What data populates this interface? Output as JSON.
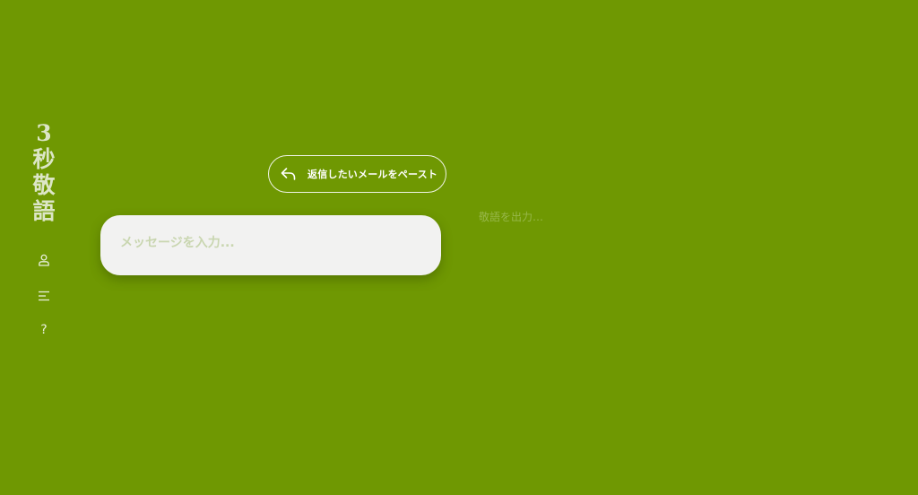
{
  "sidebar": {
    "logo_chars": [
      "3",
      "秒",
      "敬",
      "語"
    ],
    "nav": [
      {
        "icon": "user-icon"
      },
      {
        "icon": "menu-icon"
      },
      {
        "icon": "help-icon",
        "glyph": "?"
      }
    ]
  },
  "paste_button": {
    "icon": "reply-icon",
    "label": "返信したいメールをペースト"
  },
  "message_input": {
    "placeholder": "メッセージを入力...",
    "value": ""
  },
  "output": {
    "placeholder": "敬語を出力…"
  },
  "colors": {
    "background": "#6f9802",
    "input_card": "#f2f2f1",
    "logo_text": "#dce6c6",
    "output_placeholder": "#97b74a"
  }
}
